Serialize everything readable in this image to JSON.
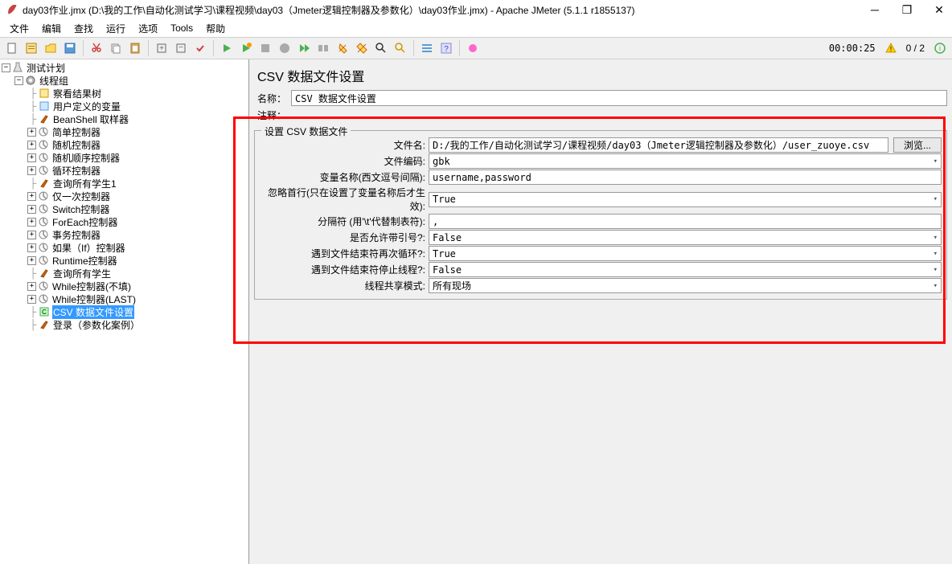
{
  "window": {
    "title": "day03作业.jmx (D:\\我的工作\\自动化测试学习\\课程视频\\day03（Jmeter逻辑控制器及参数化）\\day03作业.jmx) - Apache JMeter (5.1.1 r1855137)"
  },
  "menu": {
    "file": "文件",
    "edit": "编辑",
    "search": "查找",
    "run": "运行",
    "options": "选项",
    "tools": "Tools",
    "help": "帮助"
  },
  "toolbar": {
    "timer": "00:00:25",
    "count": "0 / 2"
  },
  "tree": {
    "root": "测试计划",
    "threadgroup": "线程组",
    "items": [
      "察看结果树",
      "用户定义的变量",
      "BeanShell 取样器",
      "简单控制器",
      "随机控制器",
      "随机顺序控制器",
      "循环控制器",
      "查询所有学生1",
      "仅一次控制器",
      "Switch控制器",
      "ForEach控制器",
      "事务控制器",
      "如果（If）控制器",
      "Runtime控制器",
      "查询所有学生",
      "While控制器(不填)",
      "While控制器(LAST)",
      "CSV 数据文件设置",
      "登录（参数化案例）"
    ]
  },
  "panel": {
    "title": "CSV 数据文件设置",
    "name_label": "名称：",
    "name_value": "CSV 数据文件设置",
    "comment_label": "注释：",
    "fieldset_legend": "设置 CSV 数据文件",
    "filename_label": "文件名:",
    "filename_value": "D:/我的工作/自动化测试学习/课程视频/day03（Jmeter逻辑控制器及参数化）/user_zuoye.csv",
    "browse": "浏览...",
    "encoding_label": "文件编码:",
    "encoding_value": "gbk",
    "varnames_label": "变量名称(西文逗号间隔):",
    "varnames_value": "username,password",
    "ignorefirst_label": "忽略首行(只在设置了变量名称后才生效):",
    "ignorefirst_value": "True",
    "delimiter_label": "分隔符 (用'\\t'代替制表符):",
    "delimiter_value": ",",
    "quoted_label": "是否允许带引号?:",
    "quoted_value": "False",
    "recycle_label": "遇到文件结束符再次循环?:",
    "recycle_value": "True",
    "stop_label": "遇到文件结束符停止线程?:",
    "stop_value": "False",
    "sharing_label": "线程共享模式:",
    "sharing_value": "所有现场"
  }
}
